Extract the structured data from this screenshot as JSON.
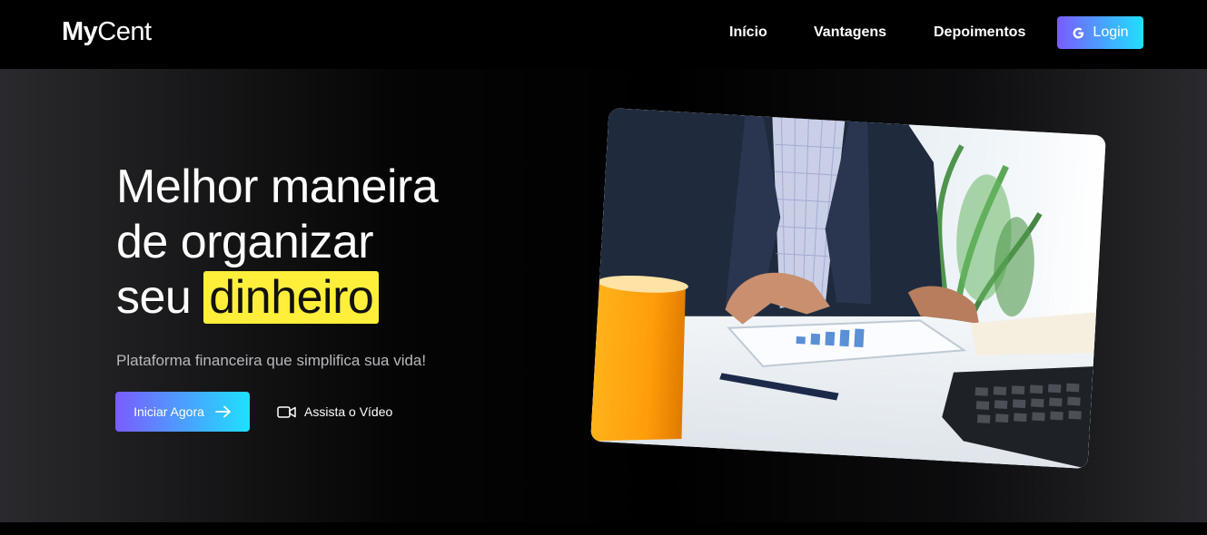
{
  "brand": {
    "logo_bold": "My",
    "logo_light": "Cent"
  },
  "nav": {
    "items": [
      {
        "label": "Início"
      },
      {
        "label": "Vantagens"
      },
      {
        "label": "Depoimentos"
      }
    ],
    "login_label": "Login",
    "login_icon": "google-icon"
  },
  "hero": {
    "headline": {
      "highlight_underline": "Melhor",
      "line1_rest": " maneira",
      "line2": "de organizar",
      "line3_prefix": "seu ",
      "highlight_yellow": "dinheiro"
    },
    "subtitle": "Plataforma financeira que simplifica sua vida!",
    "cta_label": "Iniciar Agora",
    "cta_icon": "arrow-right-icon",
    "video_label": "Assista o Vídeo",
    "video_icon": "video-camera-icon",
    "image_description_icon": "business-person-tablet-photo"
  },
  "colors": {
    "gradient_start": "#7a5cff",
    "gradient_end": "#1ee0ff",
    "underline_pink": "#e24fd6",
    "highlight_yellow": "#ffef3a",
    "background": "#000000"
  }
}
